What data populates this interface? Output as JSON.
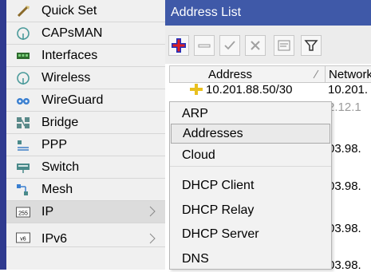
{
  "sidebar": {
    "items": [
      {
        "label": "Quick Set",
        "icon": "quick-set-icon"
      },
      {
        "label": "CAPsMAN",
        "icon": "capsman-icon"
      },
      {
        "label": "Interfaces",
        "icon": "interfaces-icon"
      },
      {
        "label": "Wireless",
        "icon": "wireless-icon"
      },
      {
        "label": "WireGuard",
        "icon": "wireguard-icon"
      },
      {
        "label": "Bridge",
        "icon": "bridge-icon"
      },
      {
        "label": "PPP",
        "icon": "ppp-icon"
      },
      {
        "label": "Switch",
        "icon": "switch-icon"
      },
      {
        "label": "Mesh",
        "icon": "mesh-icon"
      },
      {
        "label": "IP",
        "icon": "ip-icon",
        "icon_text": "255"
      },
      {
        "label": "IPv6",
        "icon": "ipv6-icon",
        "icon_text": "v6"
      }
    ],
    "accent_color": "#2f3a8f"
  },
  "window": {
    "title": "Address List",
    "title_bg": "#3f59a8"
  },
  "toolbar": {
    "buttons": [
      "add-icon",
      "remove-icon",
      "enable-icon",
      "disable-icon",
      "comment-icon",
      "filter-icon"
    ]
  },
  "table": {
    "columns": [
      "Address",
      "Network"
    ],
    "rows": [
      {
        "address": "10.201.88.50/30",
        "network": "10.201."
      },
      {
        "address": "",
        "network": "2.12.1"
      },
      {
        "address": "",
        "network": "03.98."
      },
      {
        "address": "",
        "network": "03.98."
      },
      {
        "address": "",
        "network": "03.98."
      },
      {
        "address": "",
        "network": "03.98."
      }
    ]
  },
  "submenu": {
    "items": [
      "ARP",
      "Addresses",
      "Cloud",
      "DHCP Client",
      "DHCP Relay",
      "DHCP Server",
      "DNS"
    ],
    "highlighted": "Addresses"
  }
}
